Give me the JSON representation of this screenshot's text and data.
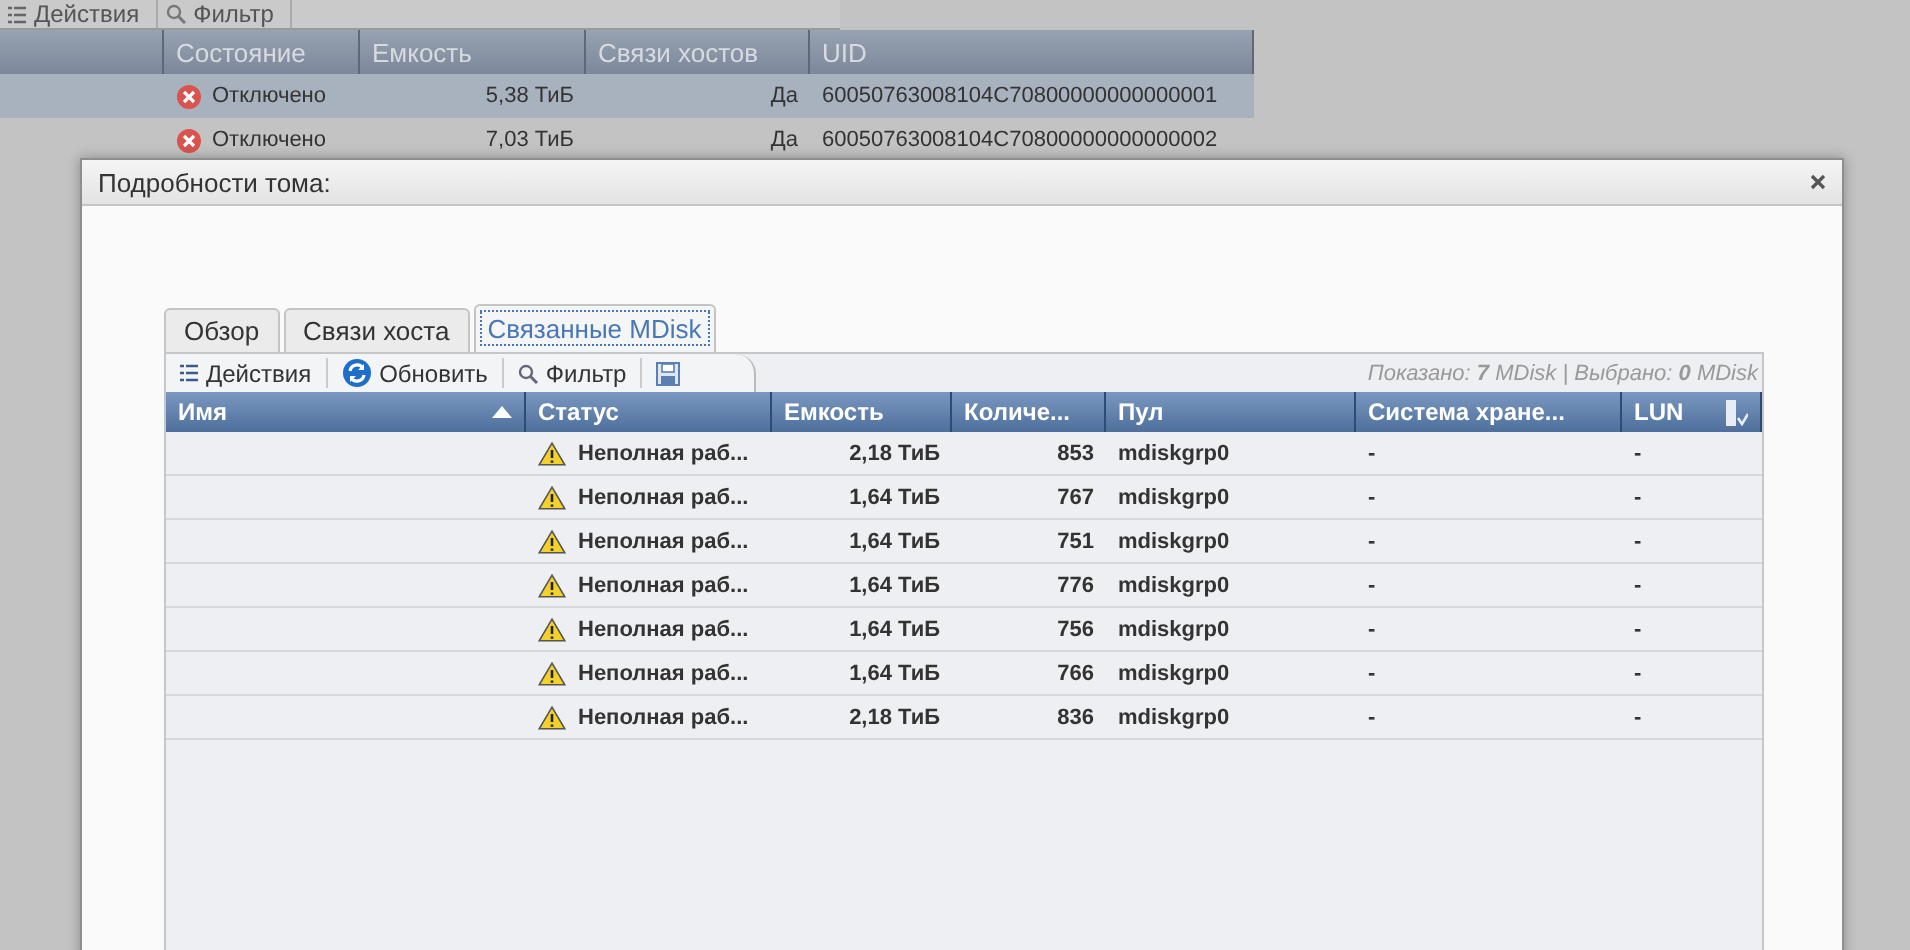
{
  "background": {
    "toolbar": [
      {
        "kind": "actions",
        "label": "Действия"
      },
      {
        "kind": "filter",
        "label": "Фильтр"
      }
    ],
    "columns": [
      {
        "label": "Состояние"
      },
      {
        "label": "Емкость"
      },
      {
        "label": "Связи хостов"
      },
      {
        "label": "UID"
      }
    ],
    "rows": [
      {
        "selected": true,
        "status": {
          "kind": "error",
          "text": "Отключено"
        },
        "capacity": "5,38 ТиБ",
        "host_links": "Да",
        "uid": "60050763008104C70800000000000001"
      },
      {
        "selected": false,
        "status": {
          "kind": "error",
          "text": "Отключено"
        },
        "capacity": "7,03 ТиБ",
        "host_links": "Да",
        "uid": "60050763008104C70800000000000002"
      }
    ]
  },
  "dialog": {
    "title": "Подробности тома:",
    "tabs": [
      {
        "label": "Обзор",
        "selected": false
      },
      {
        "label": "Связи хоста",
        "selected": false
      },
      {
        "label": "Связанные MDisk",
        "selected": true
      }
    ],
    "toolbar": [
      {
        "kind": "actions",
        "label": "Действия"
      },
      {
        "kind": "refresh",
        "label": "Обновить"
      },
      {
        "kind": "filter",
        "label": "Фильтр"
      },
      {
        "kind": "save"
      }
    ],
    "summary": "Показано: **7** MDisk | Выбрано: **0** MDisk",
    "columns": [
      {
        "label": "Имя",
        "sorted": true
      },
      {
        "label": "Статус",
        "sorted": false
      },
      {
        "label": "Емкость",
        "sorted": false
      },
      {
        "label": "Количе...",
        "sorted": false
      },
      {
        "label": "Пул",
        "sorted": false
      },
      {
        "label": "Система хране...",
        "sorted": false
      },
      {
        "label": "LUN",
        "sorted": false
      }
    ],
    "rows": [
      {
        "status": {
          "kind": "warning",
          "text": "Неполная раб..."
        },
        "capacity": "2,18 ТиБ",
        "count": "853",
        "pool": "mdiskgrp0",
        "system": "-",
        "lun": "-"
      },
      {
        "status": {
          "kind": "warning",
          "text": "Неполная раб..."
        },
        "capacity": "1,64 ТиБ",
        "count": "767",
        "pool": "mdiskgrp0",
        "system": "-",
        "lun": "-"
      },
      {
        "status": {
          "kind": "warning",
          "text": "Неполная раб..."
        },
        "capacity": "1,64 ТиБ",
        "count": "751",
        "pool": "mdiskgrp0",
        "system": "-",
        "lun": "-"
      },
      {
        "status": {
          "kind": "warning",
          "text": "Неполная раб..."
        },
        "capacity": "1,64 ТиБ",
        "count": "776",
        "pool": "mdiskgrp0",
        "system": "-",
        "lun": "-"
      },
      {
        "status": {
          "kind": "warning",
          "text": "Неполная раб..."
        },
        "capacity": "1,64 ТиБ",
        "count": "756",
        "pool": "mdiskgrp0",
        "system": "-",
        "lun": "-"
      },
      {
        "status": {
          "kind": "warning",
          "text": "Неполная раб..."
        },
        "capacity": "1,64 ТиБ",
        "count": "766",
        "pool": "mdiskgrp0",
        "system": "-",
        "lun": "-"
      },
      {
        "status": {
          "kind": "warning",
          "text": "Неполная раб..."
        },
        "capacity": "2,18 ТиБ",
        "count": "836",
        "pool": "mdiskgrp0",
        "system": "-",
        "lun": "-"
      }
    ]
  }
}
